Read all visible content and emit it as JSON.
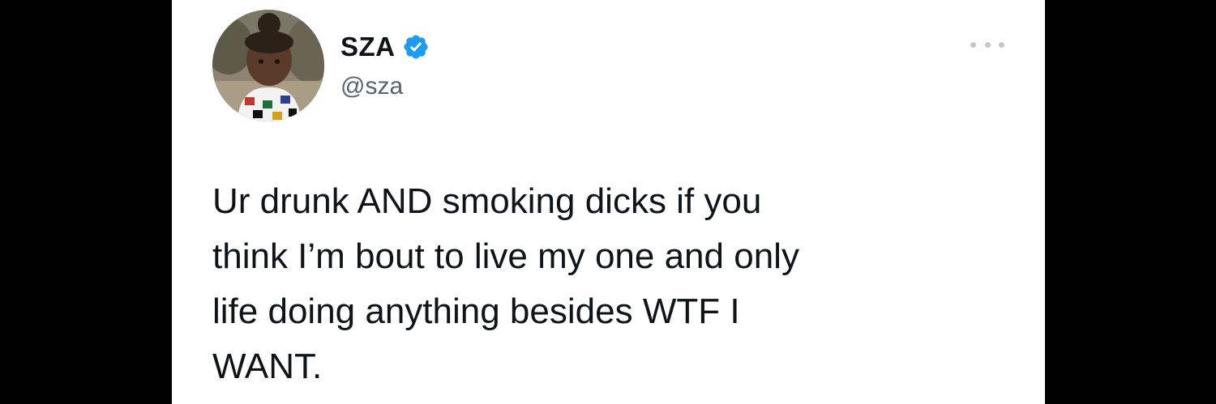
{
  "tweet": {
    "author": {
      "display_name": "SZA",
      "handle": "@sza",
      "verified_icon": "verified-badge-icon",
      "avatar": "avatar-photo"
    },
    "more_icon": "more-horizontal-icon",
    "text": "Ur drunk AND smoking dicks if you\nthink I’m bout to live my one and only\nlife doing anything besides WTF I\nWANT."
  },
  "colors": {
    "background": "#000000",
    "card": "#ffffff",
    "text_primary": "#0f1419",
    "text_secondary": "#536471",
    "verified_blue": "#1d9bf0"
  }
}
